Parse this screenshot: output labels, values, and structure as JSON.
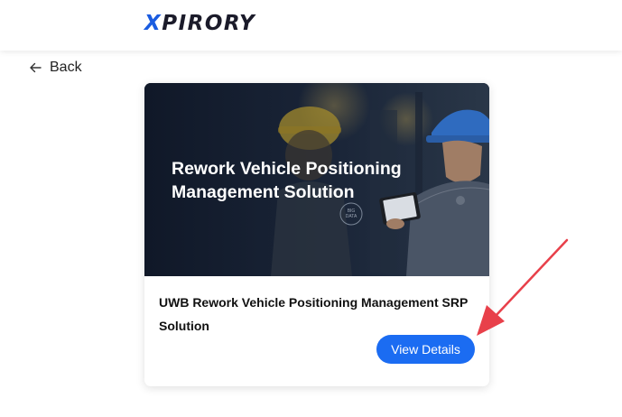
{
  "header": {
    "logo_x": "X",
    "logo_rest": "PIRORY"
  },
  "nav": {
    "back_label": "Back"
  },
  "card": {
    "banner_title": "Rework Vehicle Positioning Management Solution",
    "banner_badge": "BIG DATA",
    "title": "UWB Rework Vehicle Positioning Management SRP Solution",
    "button_label": "View Details"
  },
  "colors": {
    "accent": "#1b6cf2",
    "annotation_arrow": "#e8404a"
  }
}
